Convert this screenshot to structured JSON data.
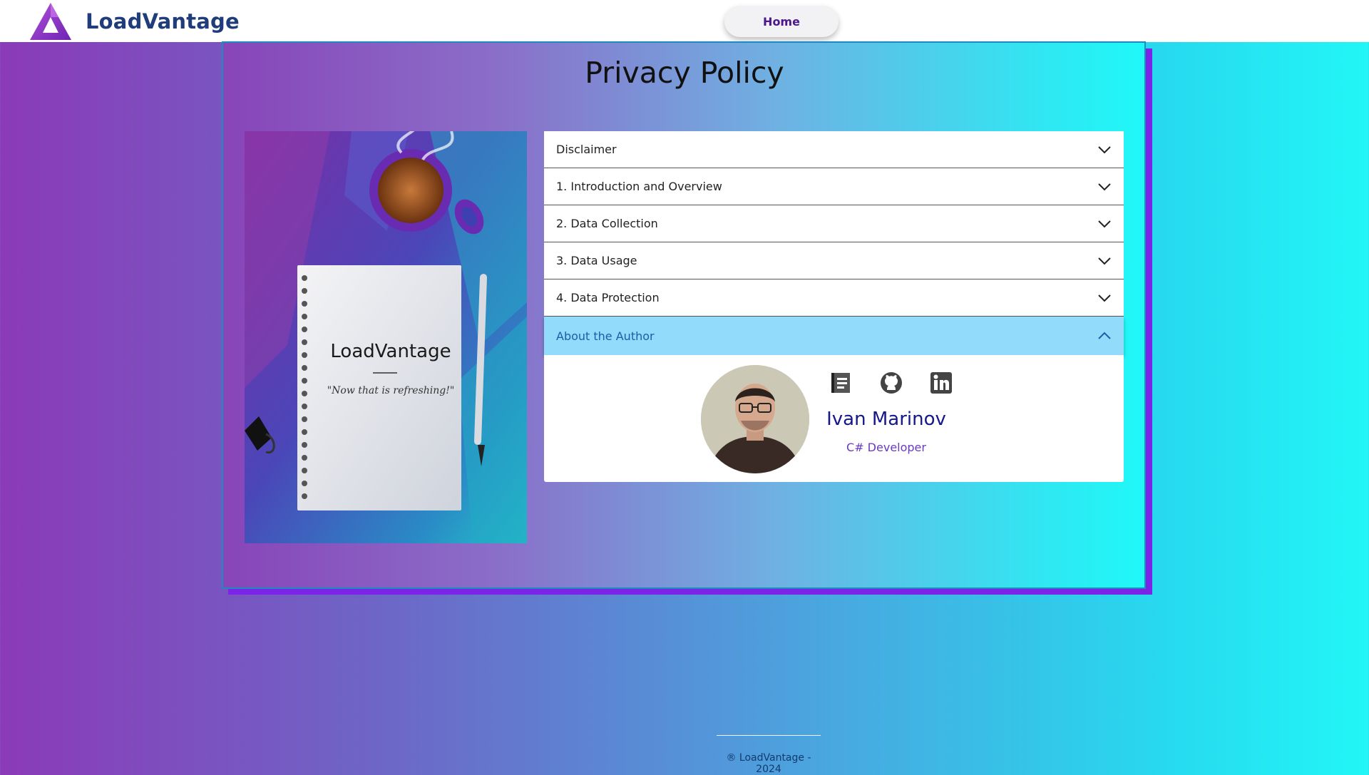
{
  "navbar": {
    "brand_name": "LoadVantage",
    "home_label": "Home"
  },
  "page": {
    "title": "Privacy Policy"
  },
  "hero_image": {
    "notebook_title": "LoadVantage",
    "notebook_quote": "\"Now that is refreshing!\""
  },
  "accordion": {
    "items": [
      {
        "label": "Disclaimer",
        "expanded": false
      },
      {
        "label": "1. Introduction and Overview",
        "expanded": false
      },
      {
        "label": "2. Data Collection",
        "expanded": false
      },
      {
        "label": "3. Data Usage",
        "expanded": false
      },
      {
        "label": "4. Data Protection",
        "expanded": false
      },
      {
        "label": "About the Author",
        "expanded": true
      }
    ]
  },
  "author": {
    "name": "Ivan Marinov",
    "role": "C# Developer",
    "socials": [
      "book-icon",
      "github-icon",
      "linkedin-icon"
    ]
  },
  "footer": {
    "text": "® LoadVantage - 2024"
  },
  "colors": {
    "brand": "#1f3d7a",
    "home_text": "#4b168f",
    "active_accordion": "#93dbfb",
    "card_shadow": "#7b23e6",
    "author_name": "#16178a",
    "author_role": "#6a3ac0"
  }
}
